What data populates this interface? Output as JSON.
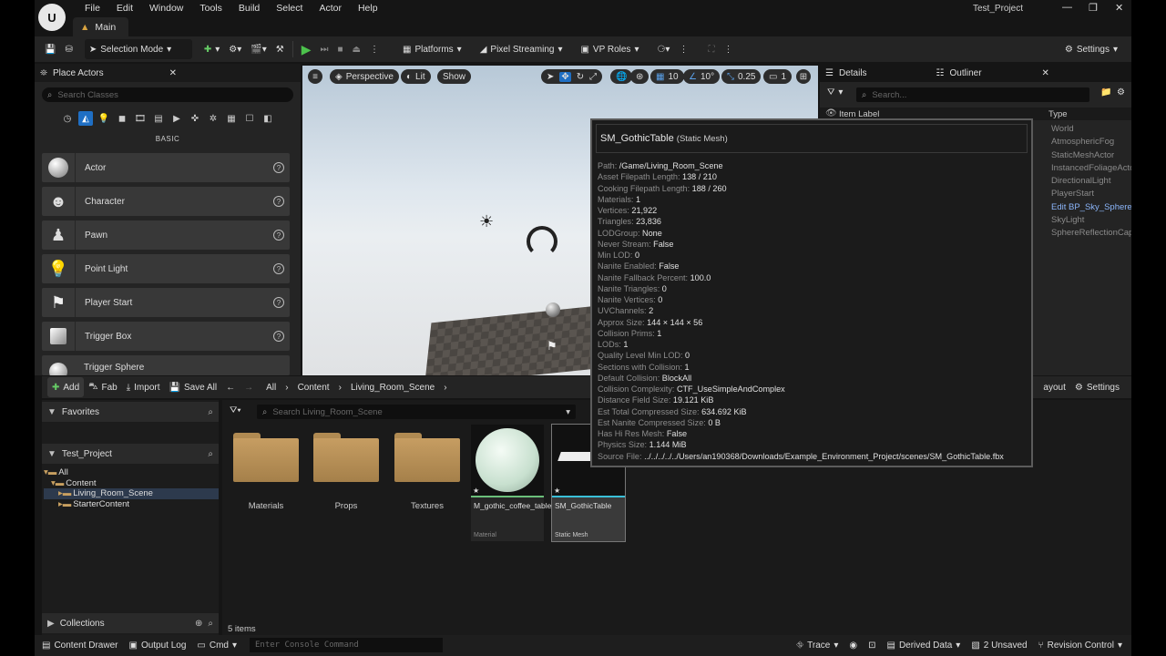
{
  "window": {
    "project": "Test_Project",
    "main_tab": "Main"
  },
  "menu": [
    "File",
    "Edit",
    "Window",
    "Tools",
    "Build",
    "Select",
    "Actor",
    "Help"
  ],
  "toolbar": {
    "selection_mode": "Selection Mode",
    "platforms": "Platforms",
    "pixel_streaming": "Pixel Streaming",
    "vp_roles": "VP Roles",
    "settings": "Settings"
  },
  "place_actors": {
    "tab": "Place Actors",
    "search_placeholder": "Search Classes",
    "category": "BASIC",
    "items": [
      "Actor",
      "Character",
      "Pawn",
      "Point Light",
      "Player Start",
      "Trigger Box",
      "Trigger Sphere"
    ]
  },
  "viewport": {
    "perspective": "Perspective",
    "lit": "Lit",
    "show": "Show",
    "grid": "10",
    "angle": "10°",
    "scale": "0.25",
    "camera": "1"
  },
  "tooltip": {
    "title": "SM_GothicTable",
    "subtitle": "(Static Mesh)",
    "rows": [
      {
        "k": "Path:",
        "v": "/Game/Living_Room_Scene"
      },
      {
        "k": "Asset Filepath Length:",
        "v": "138 / 210"
      },
      {
        "k": "Cooking Filepath Length:",
        "v": "188 / 260"
      },
      {
        "k": "Materials:",
        "v": "1"
      },
      {
        "k": "Vertices:",
        "v": "21,922"
      },
      {
        "k": "Triangles:",
        "v": "23,836"
      },
      {
        "k": "LODGroup:",
        "v": "None"
      },
      {
        "k": "Never Stream:",
        "v": "False"
      },
      {
        "k": "Min LOD:",
        "v": "0"
      },
      {
        "k": "Nanite Enabled:",
        "v": "False"
      },
      {
        "k": "Nanite Fallback Percent:",
        "v": "100.0"
      },
      {
        "k": "Nanite Triangles:",
        "v": "0"
      },
      {
        "k": "Nanite Vertices:",
        "v": "0"
      },
      {
        "k": "UVChannels:",
        "v": "2"
      },
      {
        "k": "Approx Size:",
        "v": "144 × 144 × 56"
      },
      {
        "k": "Collision Prims:",
        "v": "1"
      },
      {
        "k": "LODs:",
        "v": "1"
      },
      {
        "k": "Quality Level Min LOD:",
        "v": "0"
      },
      {
        "k": "Sections with Collision:",
        "v": "1"
      },
      {
        "k": "Default Collision:",
        "v": "BlockAll"
      },
      {
        "k": "Collision Complexity:",
        "v": "CTF_UseSimpleAndComplex"
      },
      {
        "k": "Distance Field Size:",
        "v": "19.121 KiB"
      },
      {
        "k": "Est Total Compressed Size:",
        "v": "634.692 KiB"
      },
      {
        "k": "Est Nanite Compressed Size:",
        "v": "0 B"
      },
      {
        "k": "Has Hi Res Mesh:",
        "v": "False"
      },
      {
        "k": "Physics Size:",
        "v": "1.144 MiB"
      },
      {
        "k": "Source File:",
        "v": "../../../../../Users/an190368/Downloads/Example_Environment_Project/scenes/SM_GothicTable.fbx"
      }
    ]
  },
  "outliner": {
    "details_tab": "Details",
    "outliner_tab": "Outliner",
    "search_placeholder": "Search...",
    "col_label": "Item Label",
    "col_type": "Type",
    "types": [
      "World",
      "AtmosphericFog",
      "StaticMeshActor",
      "InstancedFoliageActo",
      "DirectionalLight",
      "PlayerStart",
      "Edit BP_Sky_Sphere",
      "SkyLight",
      "SphereReflectionCap"
    ]
  },
  "content_browser": {
    "add": "Add",
    "fab": "Fab",
    "import": "Import",
    "save_all": "Save All",
    "breadcrumb": [
      "All",
      "Content",
      "Living_Room_Scene"
    ],
    "layout": "ayout",
    "settings": "Settings",
    "favorites": "Favorites",
    "project": "Test_Project",
    "tree": [
      "All",
      "Content",
      "Living_Room_Scene",
      "StarterContent"
    ],
    "search_placeholder": "Search Living_Room_Scene",
    "folders": [
      "Materials",
      "Props",
      "Textures"
    ],
    "assets": [
      {
        "name": "M_gothic_coffee_table",
        "type": "Material"
      },
      {
        "name": "SM_GothicTable",
        "type": "Static Mesh"
      }
    ],
    "collections": "Collections",
    "count": "5 items"
  },
  "statusbar": {
    "content_drawer": "Content Drawer",
    "output_log": "Output Log",
    "cmd": "Cmd",
    "console_placeholder": "Enter Console Command",
    "trace": "Trace",
    "derived_data": "Derived Data",
    "unsaved": "2 Unsaved",
    "revision": "Revision Control"
  }
}
